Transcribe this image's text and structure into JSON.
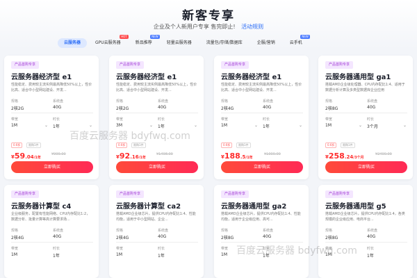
{
  "header": {
    "title": "新客专享",
    "subtitle": "企业及个人新用户专享 售完即止!",
    "rules_link": "活动规则"
  },
  "tabs": [
    {
      "label": "云服务器",
      "active": true,
      "badge": ""
    },
    {
      "label": "GPU云服务器",
      "active": false,
      "badge": "HOT"
    },
    {
      "label": "新品推荐",
      "active": false,
      "badge": "NEW"
    },
    {
      "label": "轻量云服务器",
      "active": false,
      "badge": ""
    },
    {
      "label": "流量包/存储/数据库",
      "active": false,
      "badge": ""
    },
    {
      "label": "企服/营销",
      "active": false,
      "badge": ""
    },
    {
      "label": "云手机",
      "active": false,
      "badge": "NEW"
    }
  ],
  "labels": {
    "spec": "规格",
    "disk": "系统盘",
    "bandwidth": "带宽",
    "duration": "时长",
    "buy": "立即购买",
    "tag": "产品首购专享",
    "tag_a": "0.6折",
    "tag_b": "限购1件"
  },
  "cards_row1": [
    {
      "name": "云服务器经济型 e1",
      "desc": "性能稳定、费用较主流实例最高降低50%以上，性价比高、适合中小型网站建设、开发...",
      "spec": "2核2G",
      "disk": "40G",
      "bw": "1M",
      "dur": "1年",
      "price_int": "59",
      "price_dec": ".04",
      "unit": "/1年",
      "orig": "¥999.00"
    },
    {
      "name": "云服务器经济型 e1",
      "desc": "性能稳定、费用较主流实例最高降低50%以上，性价比高、适合中小型网站建设、开发...",
      "spec": "2核2G",
      "disk": "40G",
      "bw": "3M",
      "dur": "1年",
      "price_int": "92",
      "price_dec": ".16",
      "unit": "/1年",
      "orig": "¥1498.00"
    },
    {
      "name": "云服务器经济型 e1",
      "desc": "性能稳定、费用较主流实例最高降低50%以上，性价比高、适合中小型网站建设、开发...",
      "spec": "2核4G",
      "disk": "40G",
      "bw": "1M",
      "dur": "1年",
      "price_int": "188",
      "price_dec": ".5",
      "unit": "/1年",
      "orig": "¥1900.00"
    },
    {
      "name": "云服务器通用型 ga1",
      "desc": "搭载AMD企业级处理器、CPU内存配比1:4、适用于数据分析计算及多类型数据库企业应用",
      "spec": "2核8G",
      "disk": "40G",
      "bw": "1M",
      "dur": "3个月",
      "price_int": "258",
      "price_dec": ".24",
      "unit": "/3个月",
      "orig": "¥2400.00"
    }
  ],
  "cards_row2": [
    {
      "name": "云服务器计算型 c4",
      "desc": "企业级服务，配置有性能网络、CPU内存配比1:2，数据分析、批量计算等高计算要求场..."
    },
    {
      "name": "云服务器计算型 ca2",
      "desc": "搭载AMD企业级芯片，提供CPU内存配比1:4、性能均衡，适用于中小型网站、企业..."
    },
    {
      "name": "云服务器通用型 ga2",
      "desc": "搭载AMD企业级芯片，提供CPU内存配比1:4、性能均衡，适用于企业级应用、高可..."
    },
    {
      "name": "云服务器通用型 g5",
      "desc": "搭载AMD企业级芯片，提供CPU内存配比1:4，各类规模的企业级应用、电商平台..."
    }
  ],
  "row2_values": [
    {
      "spec": "2核4G",
      "disk": "40G",
      "bw": "1M",
      "dur": "1年"
    },
    {
      "spec": "2核4G",
      "disk": "40G",
      "bw": "1M",
      "dur": "1年"
    },
    {
      "spec": "2核8G",
      "disk": "40G",
      "bw": "1M",
      "dur": "1年"
    },
    {
      "spec": "2核8G",
      "disk": "40G",
      "bw": "1M",
      "dur": "1年"
    }
  ],
  "watermark": {
    "cn": "百度云服务器",
    "url": "bdyfwq.com"
  },
  "colors": {
    "accent": "#2a6cf6",
    "price": "#ff2a2a",
    "tag": "#a33fd6"
  }
}
